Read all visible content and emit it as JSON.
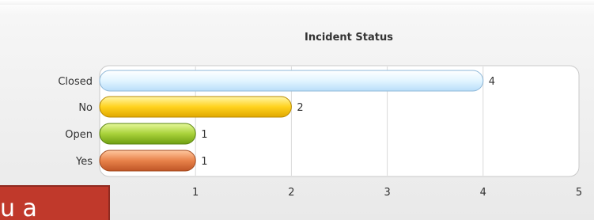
{
  "chart_data": {
    "type": "bar",
    "orientation": "horizontal",
    "title": "Incident Status",
    "categories": [
      "Closed",
      "No",
      "Open",
      "Yes"
    ],
    "values": [
      4,
      2,
      1,
      1
    ],
    "data_labels": [
      "4",
      "2",
      "1",
      "1"
    ],
    "colors": [
      "#dff3ff",
      "#ffd21e",
      "#a9d23a",
      "#e8824a"
    ],
    "xlim": [
      0,
      5
    ],
    "x_ticks": [
      "1",
      "2",
      "3",
      "4",
      "5"
    ],
    "grid": true,
    "legend": "none"
  },
  "overlay": {
    "badge_text": "u a",
    "badge_color": "#c0392b"
  }
}
